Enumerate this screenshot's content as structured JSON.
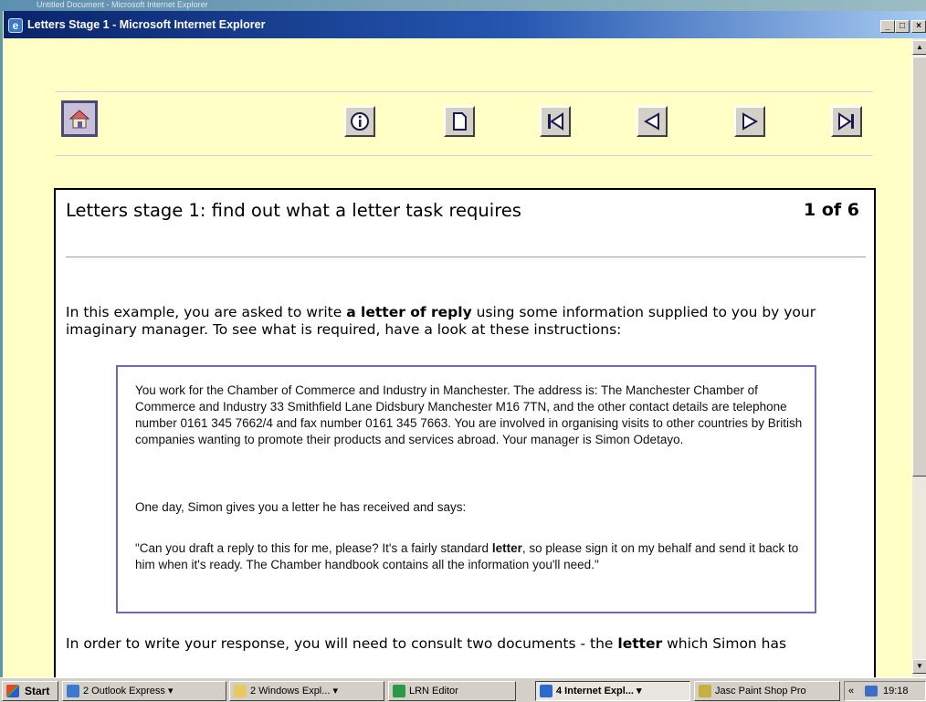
{
  "background_window": {
    "title": "Untitled Document - Microsoft Internet Explorer"
  },
  "window": {
    "title": "Letters Stage 1 - Microsoft Internet Explorer",
    "icon": "e",
    "minimize": "_",
    "maximize": "□",
    "close": "×"
  },
  "nav": {
    "buttons": [
      "home-icon",
      "info-icon",
      "page-icon",
      "first-page-icon",
      "previous-page-icon",
      "next-page-icon",
      "last-page-icon"
    ]
  },
  "content": {
    "heading": "Letters stage 1: find out what a letter task requires",
    "counter": "1 of 6",
    "intro": {
      "pre": "In this example, you are asked to write ",
      "bold": "a letter of reply",
      "post": " using some information supplied to you by your imaginary manager. To see what is required, have a look at these instructions:"
    },
    "instructions": {
      "p1": "You work for the Chamber of Commerce and Industry in Manchester. The address is: The Manchester Chamber of Commerce and Industry 33 Smithfield Lane Didsbury Manchester M16 7TN, and the other contact details are telephone number 0161 345 7662/4 and fax number 0161 345 7663. You are involved in organising visits to other countries by British companies wanting to promote their products and services abroad. Your manager is Simon Odetayo.",
      "p2": "One day, Simon gives you a letter he has received and says:",
      "p3": {
        "pre": "\"Can you draft a reply to this for me, please? It's a fairly standard ",
        "bold": "letter",
        "post": ", so please sign it on my behalf and send it back to him when it's ready. The Chamber handbook contains all the information you'll need.\""
      }
    },
    "response": {
      "pre": "In order to write your response, you will need to consult two documents - the ",
      "bold": "letter",
      "post": " which Simon has"
    }
  },
  "taskbar": {
    "start": "Start",
    "tasks": [
      {
        "label": "2 Outlook Express",
        "arrow": "▾"
      },
      {
        "label": "2 Windows Expl...",
        "arrow": "▾"
      },
      {
        "label": "LRN Editor"
      },
      {
        "label": "4 Internet Expl...",
        "arrow": "▾"
      },
      {
        "label": "Jasc Paint Shop Pro"
      }
    ],
    "tray_arrow": "«",
    "clock": "19:18"
  },
  "colors": {
    "page_background": "#ffffc6",
    "titlebar_start": "#0a246a",
    "titlebar_end": "#a6caf0",
    "instruction_border": "#6a6ab8",
    "home_button": "#c8c0d8"
  }
}
